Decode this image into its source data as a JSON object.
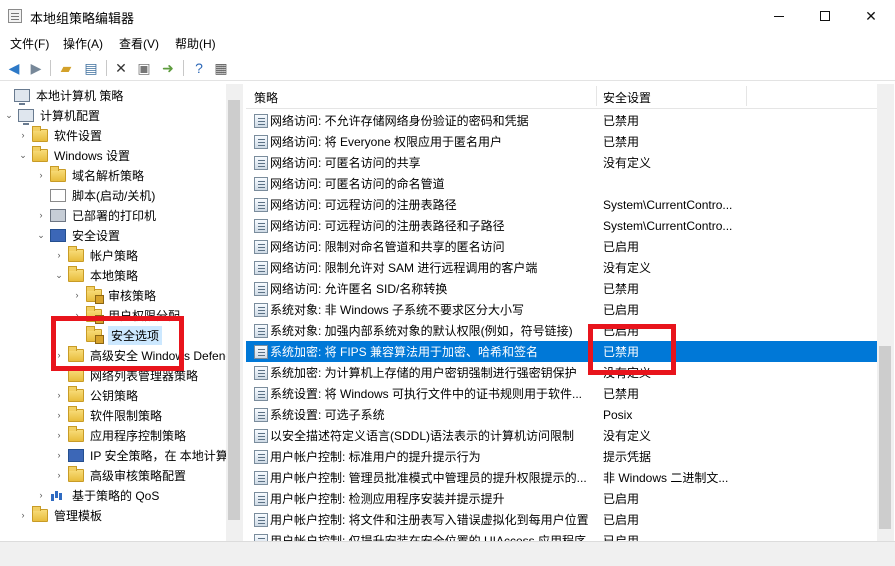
{
  "window": {
    "title": "本地组策略编辑器",
    "buttons": {
      "minimize": "",
      "maximize": "",
      "close": "✕"
    }
  },
  "menu": [
    "文件(F)",
    "操作(A)",
    "查看(V)",
    "帮助(H)"
  ],
  "toolbar": {
    "icons": [
      "back-icon",
      "forward-icon",
      "up-folder-icon",
      "show-tree-icon",
      "delete-icon",
      "properties-icon",
      "export-icon",
      "help-icon",
      "view-icon"
    ]
  },
  "tree": [
    {
      "label": "本地计算机 策略",
      "indent": 0,
      "arrow": "",
      "icon": "computer"
    },
    {
      "label": "计算机配置",
      "indent": 1,
      "arrow": "⌄",
      "icon": "computer"
    },
    {
      "label": "软件设置",
      "indent": 2,
      "arrow": "›",
      "icon": "folder"
    },
    {
      "label": "Windows 设置",
      "indent": 2,
      "arrow": "⌄",
      "icon": "folder"
    },
    {
      "label": "域名解析策略",
      "indent": 3,
      "arrow": "›",
      "icon": "folder"
    },
    {
      "label": "脚本(启动/关机)",
      "indent": 3,
      "arrow": "",
      "icon": "doc"
    },
    {
      "label": "已部署的打印机",
      "indent": 3,
      "arrow": "›",
      "icon": "printer"
    },
    {
      "label": "安全设置",
      "indent": 3,
      "arrow": "⌄",
      "icon": "shield"
    },
    {
      "label": "帐户策略",
      "indent": 4,
      "arrow": "›",
      "icon": "folder"
    },
    {
      "label": "本地策略",
      "indent": 4,
      "arrow": "⌄",
      "icon": "folder"
    },
    {
      "label": "审核策略",
      "indent": 5,
      "arrow": "›",
      "icon": "lockfolder"
    },
    {
      "label": "用户权限分配",
      "indent": 5,
      "arrow": "›",
      "icon": "lockfolder"
    },
    {
      "label": "安全选项",
      "indent": 5,
      "arrow": "",
      "icon": "lockfolder",
      "selected": true
    },
    {
      "label": "高级安全 Windows Defend",
      "indent": 4,
      "arrow": "›",
      "icon": "folder"
    },
    {
      "label": "网络列表管理器策略",
      "indent": 4,
      "arrow": "",
      "icon": "folder"
    },
    {
      "label": "公钥策略",
      "indent": 4,
      "arrow": "›",
      "icon": "folder"
    },
    {
      "label": "软件限制策略",
      "indent": 4,
      "arrow": "›",
      "icon": "folder"
    },
    {
      "label": "应用程序控制策略",
      "indent": 4,
      "arrow": "›",
      "icon": "folder"
    },
    {
      "label": "IP 安全策略，在 本地计算机",
      "indent": 4,
      "arrow": "›",
      "icon": "shield"
    },
    {
      "label": "高级审核策略配置",
      "indent": 4,
      "arrow": "›",
      "icon": "folder"
    },
    {
      "label": "基于策略的 QoS",
      "indent": 3,
      "arrow": "›",
      "icon": "chart"
    },
    {
      "label": "管理模板",
      "indent": 2,
      "arrow": "›",
      "icon": "folder"
    }
  ],
  "table": {
    "headers": [
      "策略",
      "安全设置"
    ],
    "rows": [
      {
        "name": "网络访问: 不允许存储网络身份验证的密码和凭据",
        "value": "已禁用"
      },
      {
        "name": "网络访问: 将 Everyone 权限应用于匿名用户",
        "value": "已禁用"
      },
      {
        "name": "网络访问: 可匿名访问的共享",
        "value": "没有定义"
      },
      {
        "name": "网络访问: 可匿名访问的命名管道",
        "value": ""
      },
      {
        "name": "网络访问: 可远程访问的注册表路径",
        "value": "System\\CurrentContro..."
      },
      {
        "name": "网络访问: 可远程访问的注册表路径和子路径",
        "value": "System\\CurrentContro..."
      },
      {
        "name": "网络访问: 限制对命名管道和共享的匿名访问",
        "value": "已启用"
      },
      {
        "name": "网络访问: 限制允许对 SAM 进行远程调用的客户端",
        "value": "没有定义"
      },
      {
        "name": "网络访问: 允许匿名 SID/名称转换",
        "value": "已禁用"
      },
      {
        "name": "系统对象: 非 Windows 子系统不要求区分大小写",
        "value": "已启用"
      },
      {
        "name": "系统对象: 加强内部系统对象的默认权限(例如，符号链接)",
        "value": "已启用"
      },
      {
        "name": "系统加密: 将 FIPS 兼容算法用于加密、哈希和签名",
        "value": "已禁用",
        "selected": true
      },
      {
        "name": "系统加密: 为计算机上存储的用户密钥强制进行强密钥保护",
        "value": "没有定义"
      },
      {
        "name": "系统设置: 将 Windows 可执行文件中的证书规则用于软件...",
        "value": "已禁用"
      },
      {
        "name": "系统设置: 可选子系统",
        "value": "Posix"
      },
      {
        "name": "以安全描述符定义语言(SDDL)语法表示的计算机访问限制",
        "value": "没有定义"
      },
      {
        "name": "用户帐户控制: 标准用户的提升提示行为",
        "value": "提示凭据"
      },
      {
        "name": "用户帐户控制: 管理员批准模式中管理员的提升权限提示的...",
        "value": "非 Windows 二进制文..."
      },
      {
        "name": "用户帐户控制: 检测应用程序安装并提示提升",
        "value": "已启用"
      },
      {
        "name": "用户帐户控制: 将文件和注册表写入错误虚拟化到每用户位置",
        "value": "已启用"
      },
      {
        "name": "用户帐户控制: 仅提升安装在安全位置的 UIAccess 应用程序",
        "value": "已启用"
      }
    ]
  }
}
